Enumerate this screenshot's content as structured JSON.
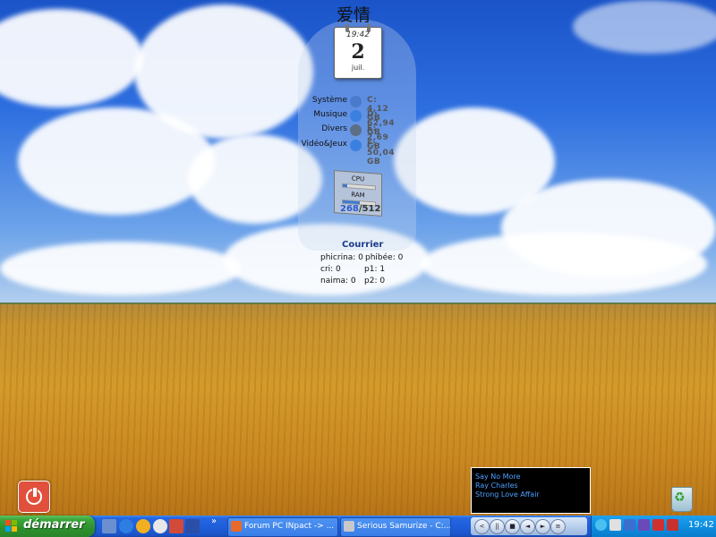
{
  "gadget": {
    "title": "爱情",
    "calendar": {
      "time": "19:42",
      "day": "2",
      "month": "juil."
    }
  },
  "drives": [
    {
      "name": "Système",
      "size": "C: 4,12 GB",
      "color": "#4a7acb"
    },
    {
      "name": "Musique",
      "size": "D: 62,94 GB",
      "color": "#3a80e0"
    },
    {
      "name": "Divers",
      "size": "E: 2,69 GB",
      "color": "#5d6f86"
    },
    {
      "name": "Vidéo&Jeux",
      "size": "F: 50,04 GB",
      "color": "#3a80e0"
    }
  ],
  "performance": {
    "cpu_label": "CPU",
    "ram_label": "RAM",
    "ram_used": "268",
    "ram_total": "/512",
    "cpu_level": 0.15,
    "ram_level": 0.52
  },
  "mail": {
    "title": "Courrier",
    "accounts": [
      {
        "text": "phicrina: 0"
      },
      {
        "text": "phibée: 0"
      },
      {
        "text": "cri: 0"
      },
      {
        "text": "p1: 1"
      },
      {
        "text": "naima: 0"
      },
      {
        "text": "p2: 0"
      }
    ]
  },
  "now_playing": {
    "track": "Say No More",
    "artist": "Ray Charles",
    "album": "Strong Love Affair"
  },
  "taskbar": {
    "start_label": "démarrer",
    "quicklaunch_chevron": "»",
    "tasks": [
      {
        "label": "Forum PC INpact -> ..."
      },
      {
        "label": "Serious Samurize - C:..."
      }
    ],
    "media_buttons": [
      "<",
      "||",
      "■",
      "◄",
      "►",
      "≡"
    ],
    "clock": "19:42"
  },
  "colors": {
    "taskbar_blue": "#1f5fdb",
    "start_green": "#3aa53a",
    "tray_blue": "#0e8ee0",
    "media_text": "#4fa0ff"
  }
}
